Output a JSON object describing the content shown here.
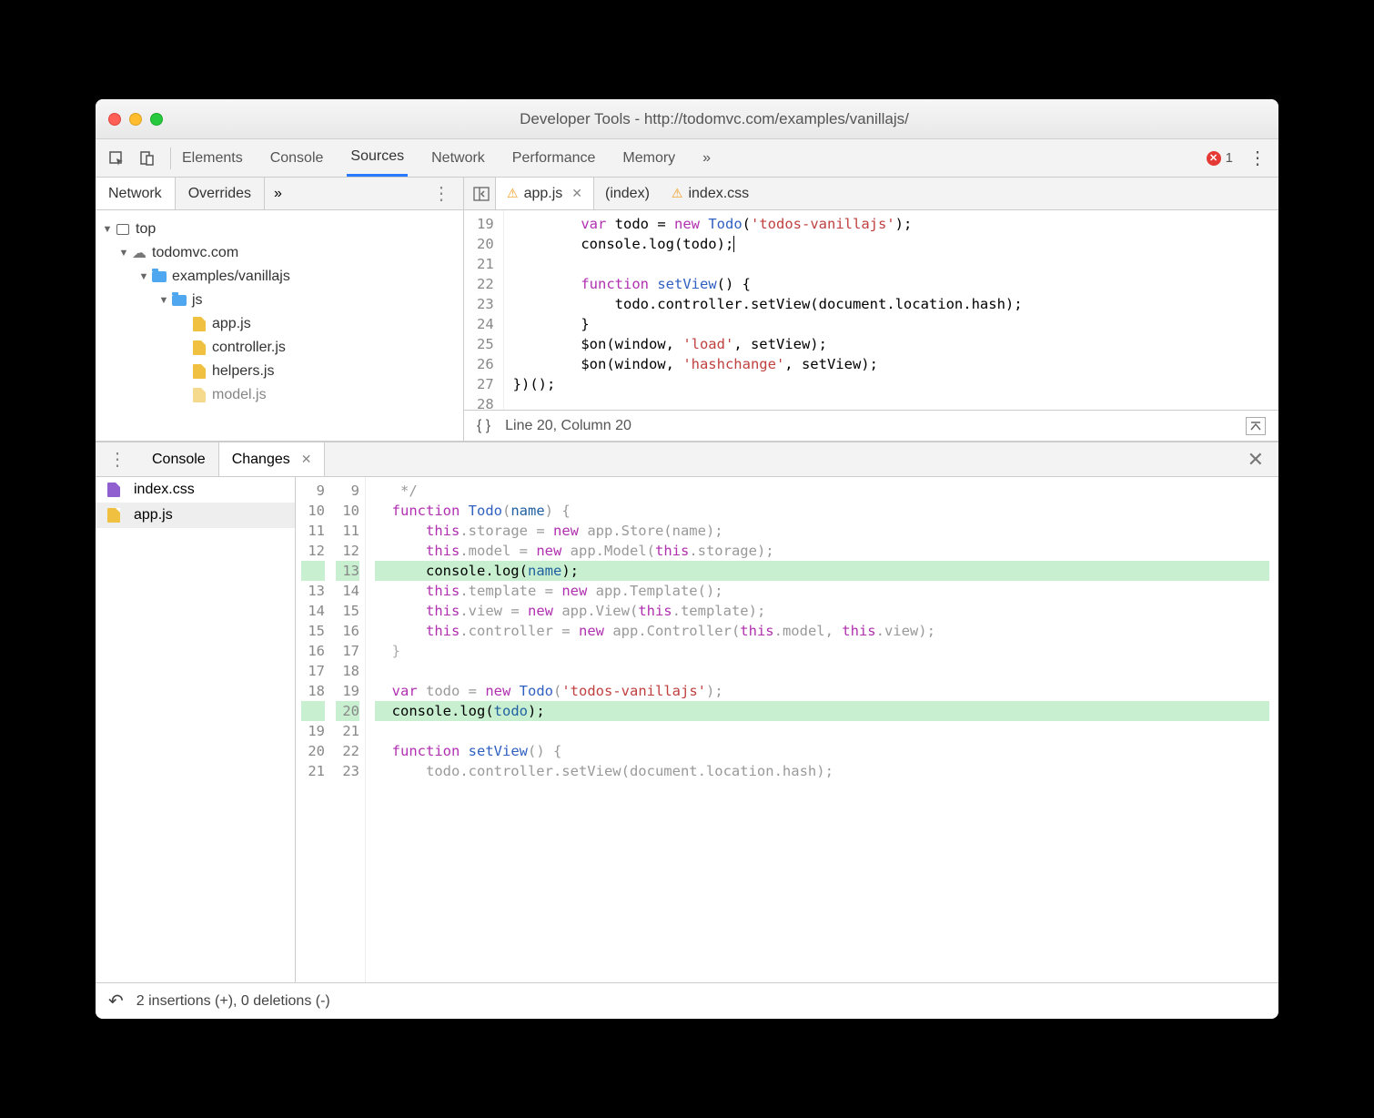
{
  "window": {
    "title": "Developer Tools - http://todomvc.com/examples/vanillajs/"
  },
  "main_tabs": {
    "elements": "Elements",
    "console": "Console",
    "sources": "Sources",
    "network": "Network",
    "performance": "Performance",
    "memory": "Memory",
    "more": "»"
  },
  "error_count": "1",
  "nav_tabs": {
    "network": "Network",
    "overrides": "Overrides",
    "more": "»"
  },
  "tree": {
    "top": "top",
    "domain": "todomvc.com",
    "folder": "examples/vanillajs",
    "jsfolder": "js",
    "files": [
      "app.js",
      "controller.js",
      "helpers.js",
      "model.js"
    ]
  },
  "editor_tabs": {
    "app": "app.js",
    "index": "(index)",
    "css": "index.css"
  },
  "source": {
    "lines": [
      {
        "n": "19",
        "html": "        <span class='kw'>var</span> todo = <span class='kw'>new</span> <span class='fn'>Todo</span>(<span class='str'>'todos-vanillajs'</span>);"
      },
      {
        "n": "20",
        "html": "        console.log(todo);<span class='cursor'></span>"
      },
      {
        "n": "21",
        "html": ""
      },
      {
        "n": "22",
        "html": "        <span class='kw'>function</span> <span class='fn'>setView</span>() {"
      },
      {
        "n": "23",
        "html": "            todo.controller.setView(document.location.hash);"
      },
      {
        "n": "24",
        "html": "        }"
      },
      {
        "n": "25",
        "html": "        $on(window, <span class='str'>'load'</span>, setView);"
      },
      {
        "n": "26",
        "html": "        $on(window, <span class='str'>'hashchange'</span>, setView);"
      },
      {
        "n": "27",
        "html": "})();"
      },
      {
        "n": "28",
        "html": ""
      }
    ]
  },
  "status": {
    "braces": "{ }",
    "pos": "Line 20, Column 20"
  },
  "drawer_tabs": {
    "console": "Console",
    "changes": "Changes"
  },
  "changes_files": {
    "css": "index.css",
    "js": "app.js"
  },
  "diff": {
    "rows": [
      {
        "l": "9",
        "r": "9",
        "cls": "",
        "html": "   <span class='cm'>*/</span>"
      },
      {
        "l": "10",
        "r": "10",
        "cls": "dim",
        "html": "  <span class='kw'>function</span> <span class='fn'>Todo</span>(<span class='num'>name</span>) {"
      },
      {
        "l": "11",
        "r": "11",
        "cls": "dim",
        "html": "      <span class='kw'>this</span>.storage = <span class='kw'>new</span> app.Store(name);"
      },
      {
        "l": "12",
        "r": "12",
        "cls": "dim",
        "html": "      <span class='kw'>this</span>.model = <span class='kw'>new</span> app.Model(<span class='kw'>this</span>.storage);"
      },
      {
        "l": "",
        "r": "13",
        "cls": "added",
        "html": "      console.log(<span class='num'>name</span>);"
      },
      {
        "l": "13",
        "r": "14",
        "cls": "dim",
        "html": "      <span class='kw'>this</span>.template = <span class='kw'>new</span> app.Template();"
      },
      {
        "l": "14",
        "r": "15",
        "cls": "dim",
        "html": "      <span class='kw'>this</span>.view = <span class='kw'>new</span> app.View(<span class='kw'>this</span>.template);"
      },
      {
        "l": "15",
        "r": "16",
        "cls": "dim",
        "html": "      <span class='kw'>this</span>.controller = <span class='kw'>new</span> app.Controller(<span class='kw'>this</span>.model, <span class='kw'>this</span>.view);"
      },
      {
        "l": "16",
        "r": "17",
        "cls": "dim",
        "html": "  <span class='brace'>}</span>"
      },
      {
        "l": "17",
        "r": "18",
        "cls": "",
        "html": ""
      },
      {
        "l": "18",
        "r": "19",
        "cls": "dim",
        "html": "  <span class='kw'>var</span> todo = <span class='kw'>new</span> <span class='fn'>Todo</span>(<span class='str'>'todos-vanillajs'</span>);"
      },
      {
        "l": "",
        "r": "20",
        "cls": "added",
        "html": "  console.log(<span class='num'>todo</span>);"
      },
      {
        "l": "19",
        "r": "21",
        "cls": "",
        "html": ""
      },
      {
        "l": "20",
        "r": "22",
        "cls": "dim",
        "html": "  <span class='kw'>function</span> <span class='fn'>setView</span>() {"
      },
      {
        "l": "21",
        "r": "23",
        "cls": "dim",
        "html": "      todo.controller.setView(document.location.hash);"
      }
    ]
  },
  "diff_status": {
    "text": "2 insertions (+), 0 deletions (-)"
  }
}
